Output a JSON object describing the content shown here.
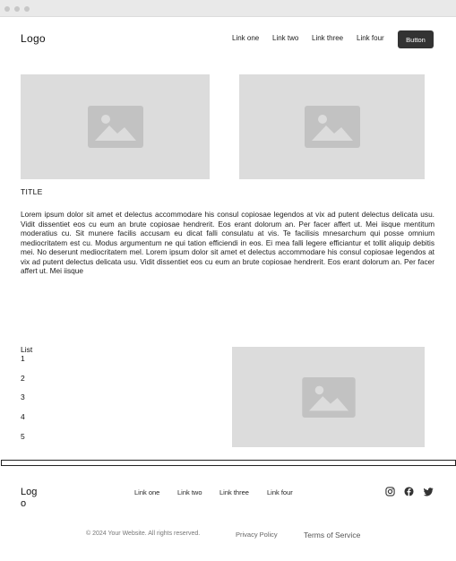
{
  "header": {
    "logo": "Logo",
    "links": [
      "Link one",
      "Link two",
      "Link three",
      "Link four"
    ],
    "button_label": "Button"
  },
  "content": {
    "title": "TITLE",
    "paragraph": "Lorem ipsum dolor sit amet et delectus accommodare his consul copiosae legendos at vix ad putent delectus delicata usu. Vidit dissentiet eos cu eum an brute copiosae hendrerit. Eos erant dolorum an. Per facer affert ut. Mei iisque mentitum moderatius cu. Sit munere facilis accusam eu dicat falli consulatu at vis. Te facilisis mnesarchum qui posse omnium mediocritatem est cu. Modus argumentum ne qui tation efficiendi in eos. Ei mea falli legere efficiantur et tollit aliquip debitis mei. No deserunt mediocritatem mel. Lorem ipsum dolor sit amet et delectus accommodare his consul copiosae legendos at vix ad putent delectus delicata usu. Vidit dissentiet eos cu eum an brute copiosae hendrerit. Eos erant dolorum an. Per facer affert ut. Mei iisque",
    "list_title": "List",
    "list_items": [
      "1",
      "2",
      "3",
      "4",
      "5"
    ]
  },
  "footer": {
    "logo": "Logo",
    "links": [
      "Link one",
      "Link two",
      "Link three",
      "Link four"
    ],
    "social_icons": [
      "instagram-icon",
      "facebook-icon",
      "twitter-icon"
    ],
    "copyright": "© 2024 Your Website. All rights reserved.",
    "privacy_label": "Privacy Policy",
    "terms_label": "Terms of Service"
  },
  "colors": {
    "placeholder_bg": "#dcdcdc",
    "placeholder_icon": "#c2c2c2",
    "button_bg": "#333333"
  }
}
